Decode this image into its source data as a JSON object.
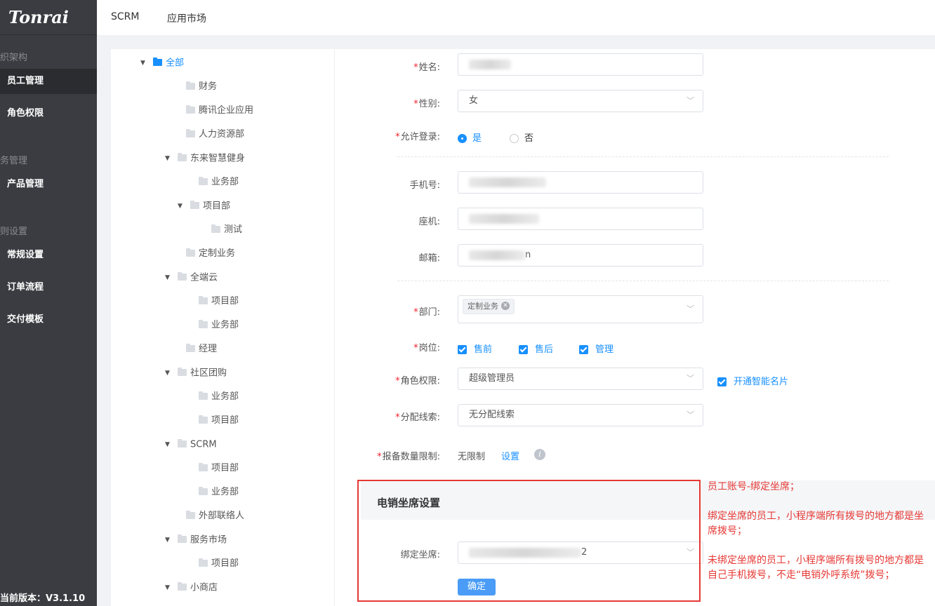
{
  "sidebar": {
    "logo": "Tonrai",
    "groups": [
      "织架构",
      "务管理",
      "则设置"
    ],
    "items": [
      "员工管理",
      "角色权限",
      "产品管理",
      "常规设置",
      "订单流程",
      "交付模板"
    ],
    "version": "当前版本：V3.1.10"
  },
  "header": {
    "tabs": [
      "SCRM",
      "应用市场"
    ]
  },
  "tree": [
    {
      "label": "全部",
      "level": 0,
      "expanded": true,
      "root": true
    },
    {
      "label": "财务",
      "level": 1
    },
    {
      "label": "腾讯企业应用",
      "level": 1
    },
    {
      "label": "人力资源部",
      "level": 1
    },
    {
      "label": "东来智慧健身",
      "level": 1,
      "expanded": true
    },
    {
      "label": "业务部",
      "level": 2
    },
    {
      "label": "项目部",
      "level": 2,
      "expanded": true
    },
    {
      "label": "测试",
      "level": 3
    },
    {
      "label": "定制业务",
      "level": 1
    },
    {
      "label": "全端云",
      "level": 1,
      "expanded": true
    },
    {
      "label": "项目部",
      "level": 2
    },
    {
      "label": "业务部",
      "level": 2
    },
    {
      "label": "经理",
      "level": 1
    },
    {
      "label": "社区团购",
      "level": 1,
      "expanded": true
    },
    {
      "label": "业务部",
      "level": 2
    },
    {
      "label": "项目部",
      "level": 2
    },
    {
      "label": "SCRM",
      "level": 1,
      "expanded": true
    },
    {
      "label": "项目部",
      "level": 2
    },
    {
      "label": "业务部",
      "level": 2
    },
    {
      "label": "外部联络人",
      "level": 1
    },
    {
      "label": "服务市场",
      "level": 1,
      "expanded": true
    },
    {
      "label": "项目部",
      "level": 2
    },
    {
      "label": "小商店",
      "level": 1,
      "expanded": true
    }
  ],
  "form": {
    "name_label": "姓名:",
    "gender_label": "性别:",
    "gender_value": "女",
    "login_label": "允许登录:",
    "login_yes": "是",
    "login_no": "否",
    "phone_label": "手机号:",
    "landline_label": "座机:",
    "email_label": "邮箱:",
    "email_partial_start": "",
    "email_partial_end": "n",
    "dept_label": "部门:",
    "dept_tag": "定制业务",
    "post_label": "岗位:",
    "posts": [
      "售前",
      "售后",
      "管理"
    ],
    "role_label": "角色权限:",
    "role_value": "超级管理员",
    "smart_card": "开通智能名片",
    "clue_label": "分配线索:",
    "clue_value": "无分配线索",
    "limit_label": "报备数量限制:",
    "limit_value": "无限制",
    "limit_link": "设置",
    "seat_section_title": "电销坐席设置",
    "bind_label": "绑定坐席:",
    "bind_end": "2",
    "confirm": "确定"
  },
  "notes": [
    "员工账号-绑定坐席；",
    "绑定坐席的员工，小程序端所有拨号的地方都是坐席拨号；",
    "未绑定坐席的员工，小程序端所有拨号的地方都是自己手机拨号，不走“电销外呼系统”拨号；"
  ],
  "colors": {
    "accent": "#1890ff",
    "annotation": "#e53935",
    "sidebar": "#3a3c41"
  }
}
